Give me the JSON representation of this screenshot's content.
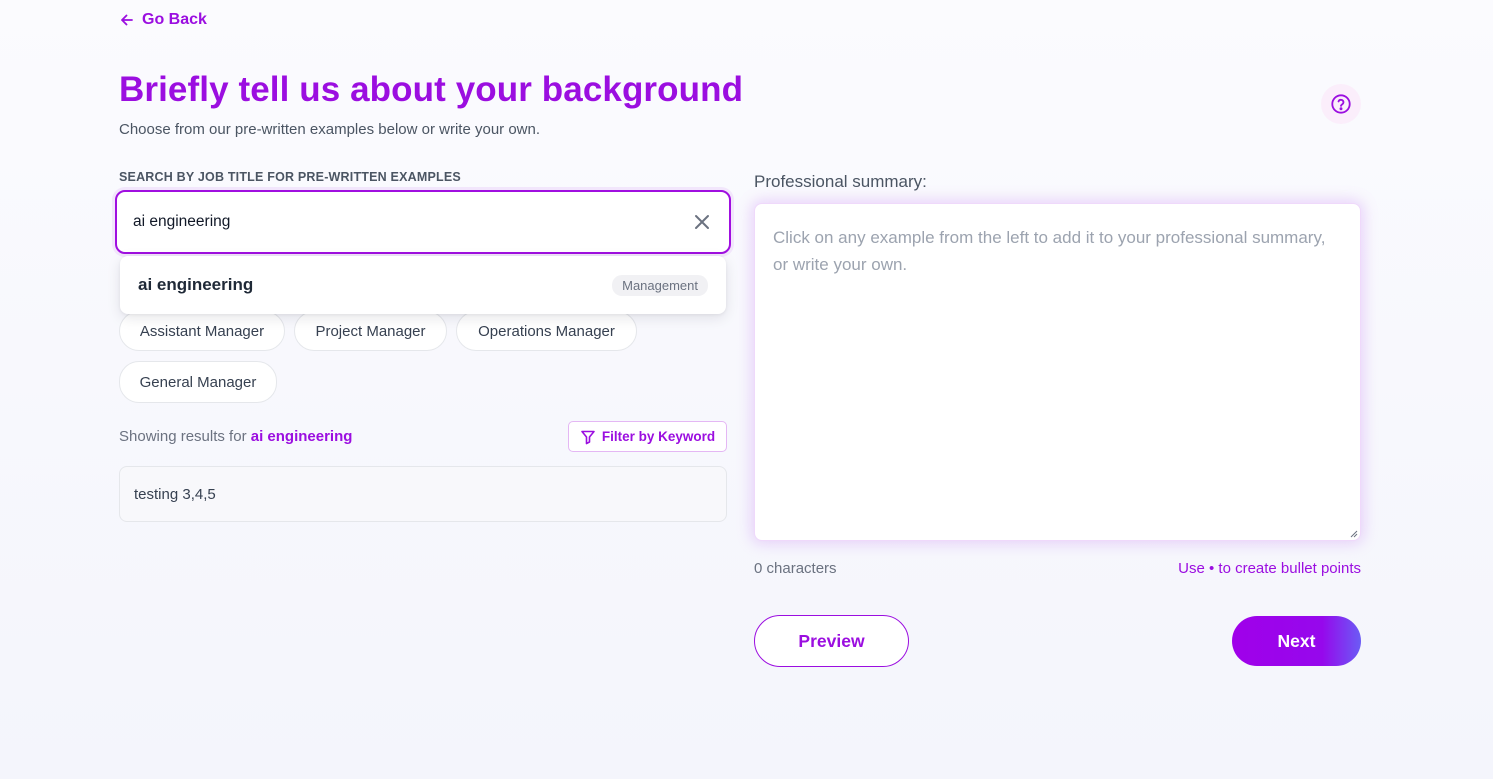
{
  "nav": {
    "back_label": "Go Back"
  },
  "header": {
    "title": "Briefly tell us about your background",
    "subtitle": "Choose from our pre-written examples below or write your own."
  },
  "search": {
    "label": "SEARCH BY JOB TITLE FOR PRE-WRITTEN EXAMPLES",
    "value": "ai engineering",
    "suggestion": {
      "name": "ai engineering",
      "category": "Management"
    }
  },
  "chips": [
    "Assistant Manager",
    "Project Manager",
    "Operations Manager",
    "General Manager"
  ],
  "results": {
    "prefix": "Showing results for ",
    "query": "ai engineering",
    "filter_label": "Filter by Keyword",
    "examples": [
      "testing 3,4,5"
    ]
  },
  "summary": {
    "label": "Professional summary:",
    "placeholder": "Click on any example from the left to add it to your professional summary, or write your own.",
    "char_count": "0 characters",
    "hint": "Use • to create bullet points"
  },
  "actions": {
    "preview": "Preview",
    "next": "Next"
  },
  "colors": {
    "accent": "#9b0ee0",
    "next_gradient_end": "#6b5cf5"
  },
  "icons": [
    "arrow-left-icon",
    "help-circle-icon",
    "close-icon",
    "filter-icon"
  ]
}
